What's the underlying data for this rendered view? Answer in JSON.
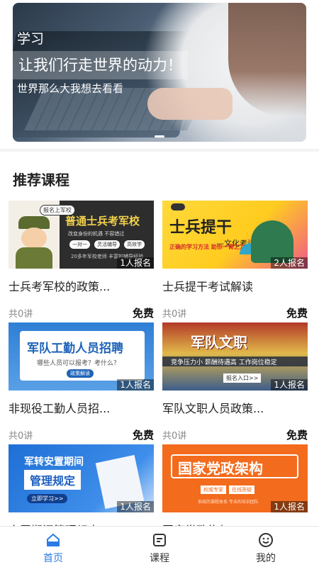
{
  "banner": {
    "tag": "学习",
    "headline": "让我们行走世界的动力！",
    "subline": "世界那么大我想去看看"
  },
  "section": {
    "title": "推荐课程"
  },
  "courses": [
    {
      "title": "士兵考军校的政策...",
      "lessons": "共0讲",
      "price": "免费",
      "enroll": "1人报名",
      "thumb": {
        "bubble": "报名上军校",
        "head": "普通士兵考军校",
        "sub": "改变身份的机遇  不容错过",
        "pills": [
          "一对一",
          "灵活辅导",
          "高效学"
        ],
        "foot": "20多年军校老师  丰富的辅导经验"
      }
    },
    {
      "title": "士兵提干考试解读",
      "lessons": "共0讲",
      "price": "免费",
      "enroll": "2人报名",
      "thumb": {
        "head": "士兵提干",
        "sub": "—文化考试",
        "red": "正确的学习方法 助你一臂之力！"
      }
    },
    {
      "title": "非现役工勤人员招...",
      "lessons": "共0讲",
      "price": "免费",
      "enroll": "1人报名",
      "thumb": {
        "head": "军队工勤人员招聘",
        "sub": "哪些人员可以报考？考什么？",
        "btn": "政策解读"
      }
    },
    {
      "title": "军队文职人员政策...",
      "lessons": "共0讲",
      "price": "免费",
      "enroll": "1人报名",
      "thumb": {
        "head": "军队文职",
        "sub": "竞争压力小  薪酬待遇高  工作岗位稳定",
        "btn": "报名入口>>"
      }
    },
    {
      "title": "安置期间管理规定",
      "lessons": "",
      "price": "",
      "enroll": "1人报名",
      "thumb": {
        "head": "军转安置期间",
        "plate": "管理规定",
        "btn": "立即学习>>"
      }
    },
    {
      "title": "国家党政构架",
      "lessons": "",
      "price": "",
      "enroll": "1人报名",
      "thumb": {
        "head": "国家党政架构",
        "tags": [
          "权威专家",
          "在线答疑"
        ],
        "foot": "系统的课程体系  专业的培训团队"
      }
    }
  ],
  "tabbar": [
    {
      "label": "首页",
      "icon": "home-icon",
      "active": true
    },
    {
      "label": "课程",
      "icon": "course-icon",
      "active": false
    },
    {
      "label": "我的",
      "icon": "profile-icon",
      "active": false
    }
  ],
  "colors": {
    "accent": "#2c7be5",
    "background": "#f2f3f5"
  }
}
